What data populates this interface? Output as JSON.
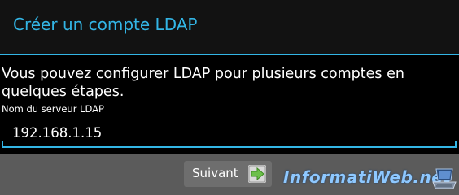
{
  "dialog": {
    "title": "Créer un compte LDAP",
    "description": "Vous pouvez configurer LDAP pour plusieurs comptes en quelques étapes.",
    "server_field": {
      "label": "Nom du serveur LDAP",
      "value": "192.168.1.15"
    }
  },
  "footer": {
    "next_label": "Suivant",
    "next_icon": "arrow-right-icon"
  },
  "watermark": {
    "text": "InformatiWeb.net",
    "icon": "laptop-icon"
  },
  "colors": {
    "accent": "#33b5e5",
    "background": "#000000",
    "footer": "#5b5b5b",
    "arrow": "#6cc04a"
  }
}
